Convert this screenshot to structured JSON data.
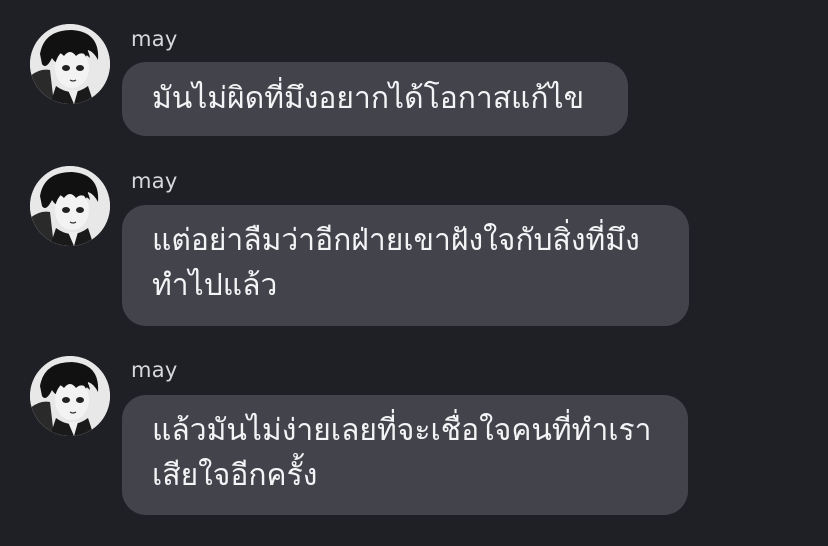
{
  "chat": {
    "messages": [
      {
        "sender": "may",
        "avatar_icon": "profile-avatar-icon",
        "lines": [
          "มันไม่ผิดที่มึงอยากได้โอกาสแก้ไข"
        ]
      },
      {
        "sender": "may",
        "avatar_icon": "profile-avatar-icon",
        "lines": [
          "แต่อย่าลืมว่าอีกฝ่ายเขาฝังใจกับสิ่งที่มึง",
          "ทำไปแล้ว"
        ]
      },
      {
        "sender": "may",
        "avatar_icon": "profile-avatar-icon",
        "lines": [
          "แล้วมันไม่ง่ายเลยที่จะเชื่อใจคนที่ทำเรา",
          "เสียใจอีกครั้ง"
        ]
      }
    ]
  },
  "colors": {
    "background": "#1f2026",
    "bubble": "#42434b",
    "text": "#f4f4f6",
    "sender": "#d7d8dd"
  }
}
